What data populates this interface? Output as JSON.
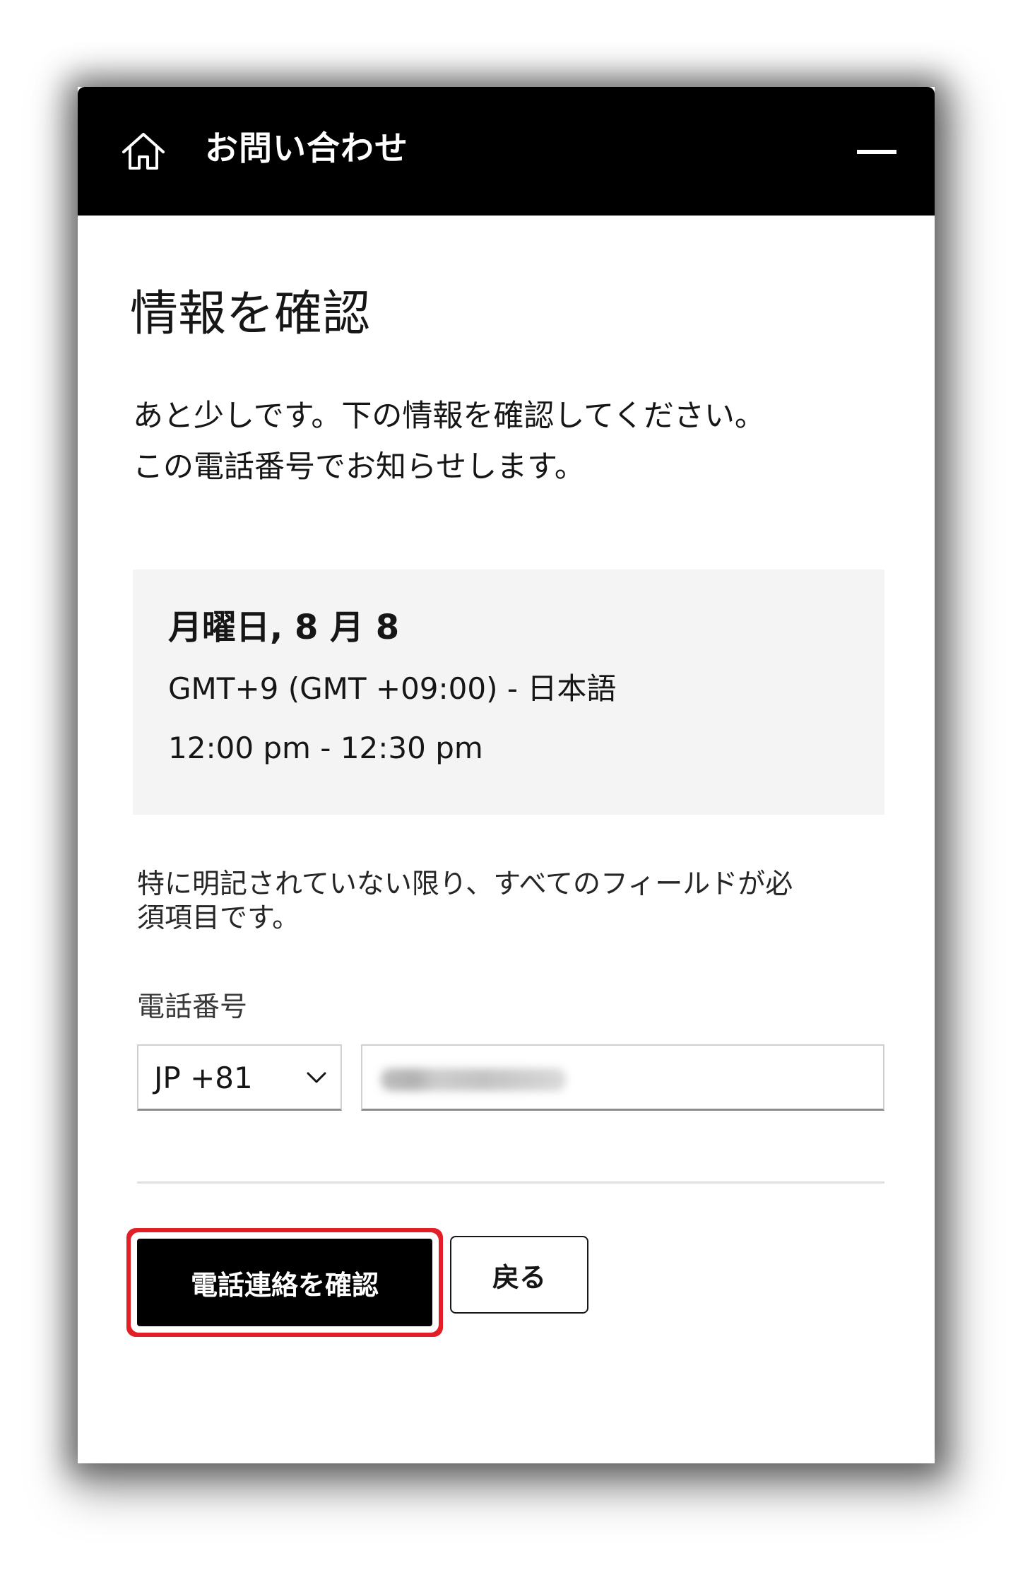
{
  "header": {
    "title": "お問い合わせ",
    "home_icon": "home-icon",
    "minimize_icon": "minimize-icon",
    "background_color": "#000000"
  },
  "page": {
    "title": "情報を確認",
    "intro_line1": "あと少しです。下の情報を確認してください。",
    "intro_line2": "この電話番号でお知らせします。"
  },
  "appointment": {
    "date": "月曜日, 8 月 8",
    "timezone": "GMT+9 (GMT +09:00) - 日本語",
    "time": "12:00 pm - 12:30 pm"
  },
  "form": {
    "required_note_line1": "特に明記されていない限り、すべてのフィールドが必",
    "required_note_line2": "須項目です。",
    "phone_label": "電話番号",
    "country_code": "JP +81",
    "phone_value_obscured": true
  },
  "actions": {
    "confirm_label": "電話連絡を確認",
    "back_label": "戻る",
    "highlight_color": "#e21f26"
  }
}
